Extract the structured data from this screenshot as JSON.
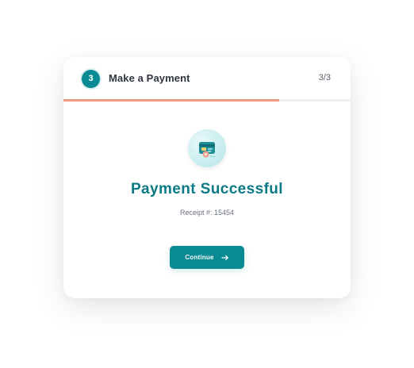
{
  "header": {
    "step_number": "3",
    "title": "Make a Payment",
    "step_count": "3/3",
    "progress": 0.75
  },
  "icon": {
    "name": "credit-card-icon"
  },
  "content": {
    "success_title": "Payment Successful",
    "receipt_text": "Receipt #: 15454"
  },
  "action": {
    "continue_label": "Continue",
    "arrow_icon": "arrow-right-icon"
  },
  "colors": {
    "accent": "#0a8a92",
    "progress": "#ee9a84",
    "success_text": "#0b7a85"
  }
}
